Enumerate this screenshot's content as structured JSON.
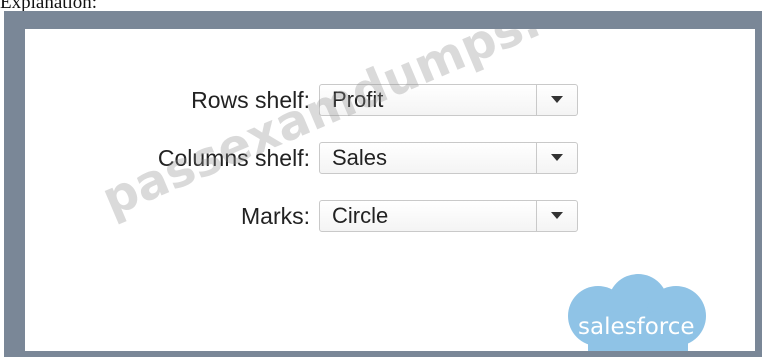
{
  "caption": "Explanation:",
  "fields": [
    {
      "label": "Rows shelf:",
      "value": "Profit"
    },
    {
      "label": "Columns shelf:",
      "value": "Sales"
    },
    {
      "label": "Marks:",
      "value": "Circle"
    }
  ],
  "watermark": "passexamdumps.com",
  "logo": {
    "text": "salesforce",
    "color": "#8fc3e6"
  },
  "colors": {
    "frame": "#7a8797",
    "panel": "#ffffff"
  },
  "icons": [
    "chevron-down-icon"
  ]
}
